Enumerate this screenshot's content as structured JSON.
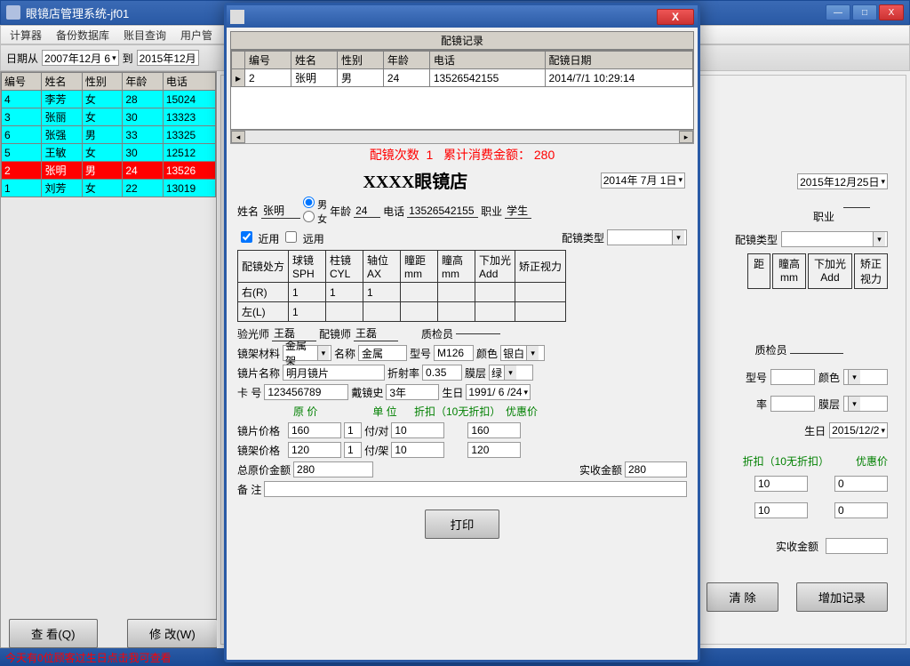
{
  "window": {
    "title": "眼镜店管理系统-jf01"
  },
  "winbtns": {
    "min": "—",
    "max": "□",
    "close": "X"
  },
  "menu": [
    "计算器",
    "备份数据库",
    "账目查询",
    "用户管"
  ],
  "topbar": {
    "from_label": "日期从",
    "from": "2007年12月 6",
    "to_label": "到",
    "to": "2015年12月"
  },
  "leftgrid": {
    "cols": [
      "编号",
      "姓名",
      "性别",
      "年龄",
      "电话"
    ],
    "rows": [
      {
        "c": [
          "4",
          "李芳",
          "女",
          "28",
          "15024"
        ],
        "cls": "cyan"
      },
      {
        "c": [
          "3",
          "张丽",
          "女",
          "30",
          "13323"
        ],
        "cls": "cyan"
      },
      {
        "c": [
          "6",
          "张强",
          "男",
          "33",
          "13325"
        ],
        "cls": "cyan"
      },
      {
        "c": [
          "5",
          "王敏",
          "女",
          "30",
          "12512"
        ],
        "cls": "cyan"
      },
      {
        "c": [
          "2",
          "张明",
          "男",
          "24",
          "13526"
        ],
        "cls": "red"
      },
      {
        "c": [
          "1",
          "刘芳",
          "女",
          "22",
          "13019"
        ],
        "cls": "cyan"
      }
    ]
  },
  "buttons": {
    "view": "查 看(Q)",
    "edit": "修 改(W)"
  },
  "status": "今天有0位顾客过生日点击我可查看",
  "right": {
    "date": "2015年12月25日",
    "occupation_label": "职业",
    "fittype_label": "配镜类型",
    "labels": {
      "ju": "距",
      "tg": "瞳高",
      "tgu": "mm",
      "add": "下加光",
      "addu": "Add",
      "cv": "矫正",
      "cvu": "视力"
    },
    "qc": "质检员",
    "xh": "型号",
    "ys": "颜色",
    "lv": "率",
    "mc": "膜层",
    "sr": "生日",
    "srv": "2015/12/2",
    "disc": "折扣（10无折扣）",
    "yh": "优惠价",
    "v10a": "10",
    "v0a": "0",
    "v10b": "10",
    "v0b": "0",
    "sj": "实收金额",
    "clear": "清 除",
    "add_rec": "增加记录"
  },
  "modal": {
    "title": "配镜记录",
    "cols": [
      "编号",
      "姓名",
      "性别",
      "年龄",
      "电话",
      "配镜日期"
    ],
    "row": [
      "2",
      "张明",
      "男",
      "24",
      "13526542155",
      "2014/7/1 10:29:14"
    ],
    "summary": {
      "count_lbl": "配镜次数",
      "count": "1",
      "spent_lbl": "累计消费金额：",
      "spent": "280"
    },
    "store": "XXXX眼镜店",
    "date": "2014年 7月 1日",
    "fields": {
      "name_lbl": "姓名",
      "name": "张明",
      "sex_m": "男",
      "sex_f": "女",
      "age_lbl": "年龄",
      "age": "24",
      "phone_lbl": "电话",
      "phone": "13526542155",
      "occ_lbl": "职业",
      "occ": "学生",
      "near": "近用",
      "far": "远用",
      "fittype": "配镜类型"
    },
    "rx": {
      "hdr": [
        "配镜处方",
        "球镜\nSPH",
        "柱镜\nCYL",
        "轴位\nAX",
        "瞳距\nmm",
        "瞳高\nmm",
        "下加光\nAdd",
        "矫正视力"
      ],
      "r": "右(R)",
      "l": "左(L)",
      "r1": "1",
      "r2": "1",
      "r3": "1",
      "l1": "1"
    },
    "staff": {
      "opt_lbl": "验光师",
      "opt": "王磊",
      "fit_lbl": "配镜师",
      "fit": "王磊",
      "qc_lbl": "质检员"
    },
    "frame": {
      "mat_lbl": "镜架材料",
      "mat": "金属架",
      "name_lbl": "名称",
      "name": "金属",
      "model_lbl": "型号",
      "model": "M126",
      "color_lbl": "颜色",
      "color": "银白"
    },
    "lens": {
      "name_lbl": "镜片名称",
      "name": "明月镜片",
      "re_lbl": "折射率",
      "re": "0.35",
      "coat_lbl": "膜层",
      "coat": "绿"
    },
    "card": {
      "no_lbl": "卡   号",
      "no": "123456789",
      "hist_lbl": "戴镜史",
      "hist": "3年",
      "bday_lbl": "生日",
      "bday": "1991/ 6 /24"
    },
    "price": {
      "p1": "原    价",
      "p2": "单 位",
      "p3": "折扣（10无折扣）",
      "p4": "优惠价",
      "lens_lbl": "镜片价格",
      "lens_p": "160",
      "lens_q": "1",
      "lens_u": "付/对",
      "lens_d": "10",
      "lens_f": "160",
      "frame_lbl": "镜架价格",
      "frame_p": "120",
      "frame_q": "1",
      "frame_u": "付/架",
      "frame_d": "10",
      "frame_f": "120",
      "total_lbl": "总原价金额",
      "total": "280",
      "actual_lbl": "实收金额",
      "actual": "280"
    },
    "remark_lbl": "备  注",
    "print": "打印"
  }
}
